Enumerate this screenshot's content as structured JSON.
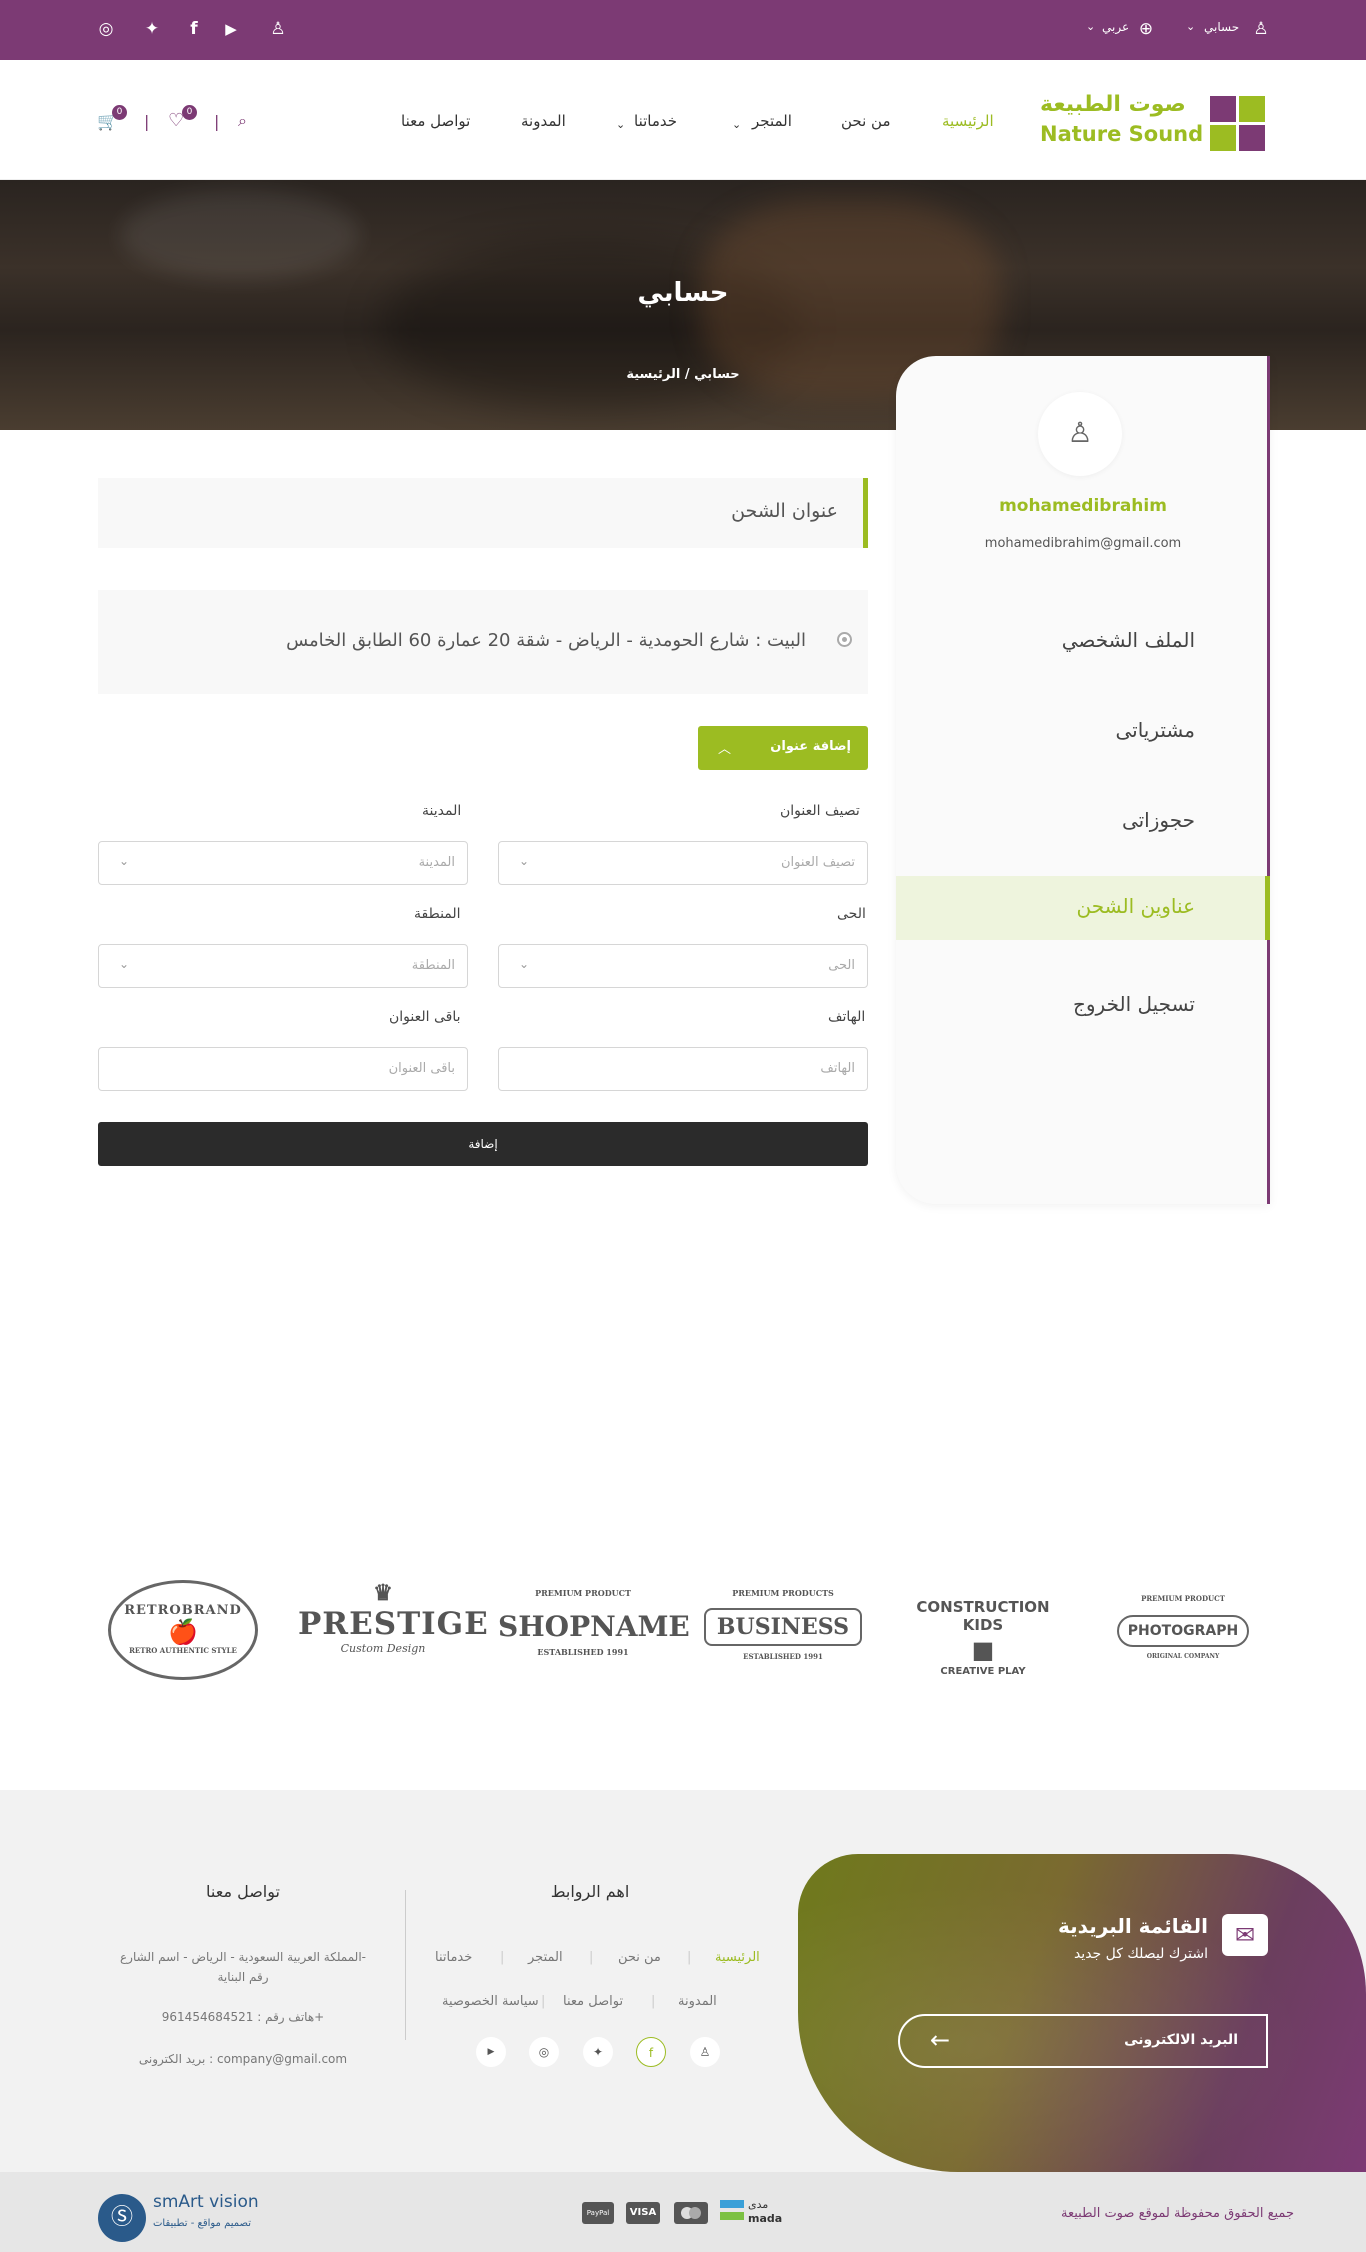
{
  "topbar": {
    "account_label": "حسابي",
    "language_label": "عربي",
    "social_icons": [
      "instagram-icon",
      "twitter-icon",
      "facebook-icon",
      "youtube-icon",
      "snapchat-icon"
    ]
  },
  "header": {
    "logo_ar": "صوت الطبيعة",
    "logo_en": "Nature Sound",
    "nav": {
      "home": "الرئيسية",
      "about": "من نحن",
      "store": "المتجر",
      "services": "خدماتنا",
      "blog": "المدونة",
      "contact": "تواصل معنا"
    },
    "wishlist_count": "0",
    "cart_count": "0"
  },
  "hero": {
    "title": "حسابي",
    "breadcrumb_home": "الرئيسية",
    "breadcrumb_sep": "/",
    "breadcrumb_current": "حسابي"
  },
  "sidebar": {
    "username": "mohamedibrahim",
    "email": "mohamedibrahim@gmail.com",
    "items": [
      {
        "label": "الملف الشخصي"
      },
      {
        "label": "مشترياتى"
      },
      {
        "label": "حجوزاتى"
      },
      {
        "label": "عناوين الشحن"
      },
      {
        "label": "تسجيل الخروج"
      }
    ]
  },
  "main": {
    "section_title": "عنوان الشحن",
    "saved_address": "البيت : شارع الحومدية - الرياض - شقة 20 عمارة 60 الطابق الخامس",
    "add_address_button": "إضافة عنوان",
    "form": {
      "address_class_label": "تصيف العنوان",
      "address_class_placeholder": "تصيف العنوان",
      "city_label": "المدينة",
      "city_placeholder": "المدينة",
      "district_label": "الحى",
      "district_placeholder": "الحى",
      "region_label": "المنطقة",
      "region_placeholder": "المنطقة",
      "phone_label": "الهاتف",
      "phone_placeholder": "الهاتف",
      "rest_label": "باقى العنوان",
      "rest_placeholder": "باقى العنوان",
      "submit": "إضافة"
    }
  },
  "brands": {
    "b1_top": "RETROBRAND",
    "b1_sub": "RETRO AUTHENTIC STYLE",
    "b2_top": "PRESTIGE",
    "b2_sub": "Custom Design",
    "b3_top": "SHOPNAME",
    "b3_pre": "PREMIUM PRODUCT",
    "b3_sub": "ESTABLISHED 1991",
    "b4_top": "BUSINESS",
    "b4_pre": "PREMIUM PRODUCTS",
    "b4_sub": "ESTABLISHED 1991",
    "b5_top": "CONSTRUCTION KIDS",
    "b5_sub": "CREATIVE PLAY",
    "b6_top": "PHOTOGRAPH",
    "b6_pre": "PREMIUM PRODUCT",
    "b6_sub": "ORIGINAL COMPANY"
  },
  "footer": {
    "newsletter_title": "القائمة البريدية",
    "newsletter_sub": "اشترك ليصلك كل جديد",
    "email_placeholder": "البريد الالكترونى",
    "links_title": "اهم الروابط",
    "links": {
      "home": "الرئيسية",
      "about": "من نحن",
      "store": "المتجر",
      "services": "خدماتنا",
      "blog": "المدونة",
      "contact": "تواصل معنا",
      "privacy": "سياسة الخصوصية"
    },
    "contact_title": "تواصل معنا",
    "address_line1": "المملكة العربية السعودية - الرياض - اسم الشارع-",
    "address_line2": "رقم البناية",
    "phone": "هاتف رقم : 961454684521+",
    "email": "بريد الكترونى : company@gmail.com"
  },
  "bottom": {
    "copyright": "جميع الحقوق محفوظة لموقع صوت الطبيعة",
    "pay_mada_ar": "مدى",
    "pay_mada_en": "mada",
    "pay_paypal": "PayPal",
    "pay_visa": "VISA",
    "credit_brand": "smArt vision",
    "credit_sub": "تصميم مواقع - تطبيقات"
  },
  "colors": {
    "brand_purple": "#7c3a74",
    "brand_green": "#9cbc22",
    "dark_button": "#2b2b2b"
  }
}
